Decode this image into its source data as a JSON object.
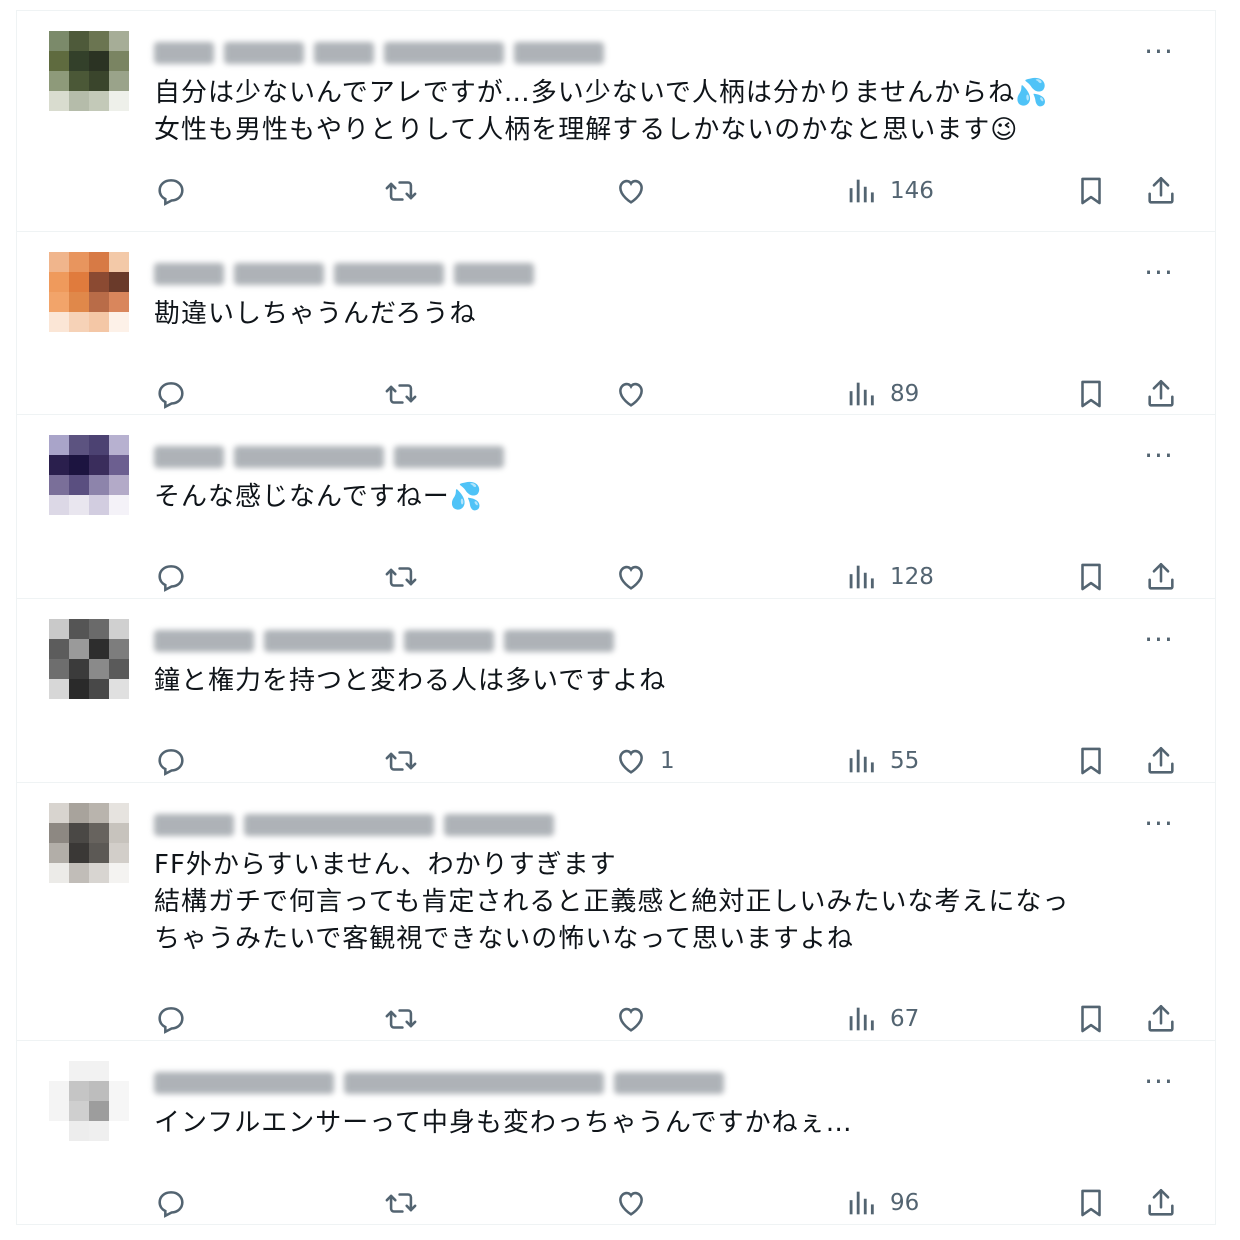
{
  "replies": [
    {
      "text": "自分は少ないんでアレですが…多い少ないで人柄は分かりませんからね💦\n女性も男性もやりとりして人柄を理解するしかないのかなと思います😉",
      "likes": "",
      "views": "146",
      "avatar_colors": [
        "#7b8a6a",
        "#4e5a3a",
        "#6b7551",
        "#a6ad97",
        "#5f6b3f",
        "#33402a",
        "#2b3323",
        "#7a8462",
        "#8e9a7a",
        "#4b5837",
        "#3a452c",
        "#9aa38a",
        "#d9dccf",
        "#b5bcaa",
        "#c3c9b8",
        "#eef0ea"
      ]
    },
    {
      "text": "勘違いしちゃうんだろうね",
      "likes": "",
      "views": "89",
      "avatar_colors": [
        "#f0b58c",
        "#e8955e",
        "#d77a45",
        "#f3c9a8",
        "#ef9a5c",
        "#e07b3d",
        "#8b4a32",
        "#6a3a2a",
        "#f2a46a",
        "#e0884a",
        "#b96c48",
        "#d9865c",
        "#fbe6d6",
        "#f6d2b7",
        "#f4c7a6",
        "#fdf1e8"
      ]
    },
    {
      "text": "そんな感じなんですねー💦",
      "likes": "",
      "views": "128",
      "avatar_colors": [
        "#a9a4c9",
        "#5c5380",
        "#4c4272",
        "#b7b1d0",
        "#2a1f4d",
        "#1c1440",
        "#3a2d5c",
        "#6c5f90",
        "#7a6f99",
        "#5a4f80",
        "#8d84ab",
        "#b3aac8",
        "#dcd8e6",
        "#e9e6ef",
        "#d2cde0",
        "#f4f2f8"
      ]
    },
    {
      "text": "鐘と権力を持つと変わる人は多いですよね",
      "likes": "1",
      "views": "55",
      "avatar_colors": [
        "#c9c9c9",
        "#555555",
        "#6a6a6a",
        "#d0d0d0",
        "#5c5c5c",
        "#9a9a9a",
        "#2d2d2d",
        "#7d7d7d",
        "#6e6e6e",
        "#3b3b3b",
        "#8a8a8a",
        "#5a5a5a",
        "#d7d7d7",
        "#2a2a2a",
        "#484848",
        "#e0e0e0"
      ]
    },
    {
      "text": "FF外からすいません、わかりすぎます\n結構ガチで何言っても肯定されると正義感と絶対正しいみたいな考えになっ\nちゃうみたいで客観視できないの怖いなって思いますよね",
      "likes": "",
      "views": "67",
      "avatar_colors": [
        "#d8d4cf",
        "#a8a39c",
        "#b9b4ad",
        "#e6e3df",
        "#8d8882",
        "#4a4845",
        "#67635e",
        "#c7c3bd",
        "#b2aea8",
        "#3a3836",
        "#5c5955",
        "#d2cec9",
        "#ecebe8",
        "#c1bdb8",
        "#d8d5d1",
        "#f4f3f1"
      ]
    },
    {
      "text": "インフルエンサーって中身も変わっちゃうんですかねぇ…",
      "likes": "",
      "views": "96",
      "avatar_colors": [
        "#ffffff",
        "#f2f2f2",
        "#f2f2f2",
        "#ffffff",
        "#f4f4f4",
        "#c5c5c5",
        "#bdbdbd",
        "#f6f6f6",
        "#f4f4f4",
        "#cfcfcf",
        "#9d9d9d",
        "#f6f6f6",
        "#ffffff",
        "#ededed",
        "#efefef",
        "#ffffff"
      ]
    }
  ],
  "more_label": "···"
}
